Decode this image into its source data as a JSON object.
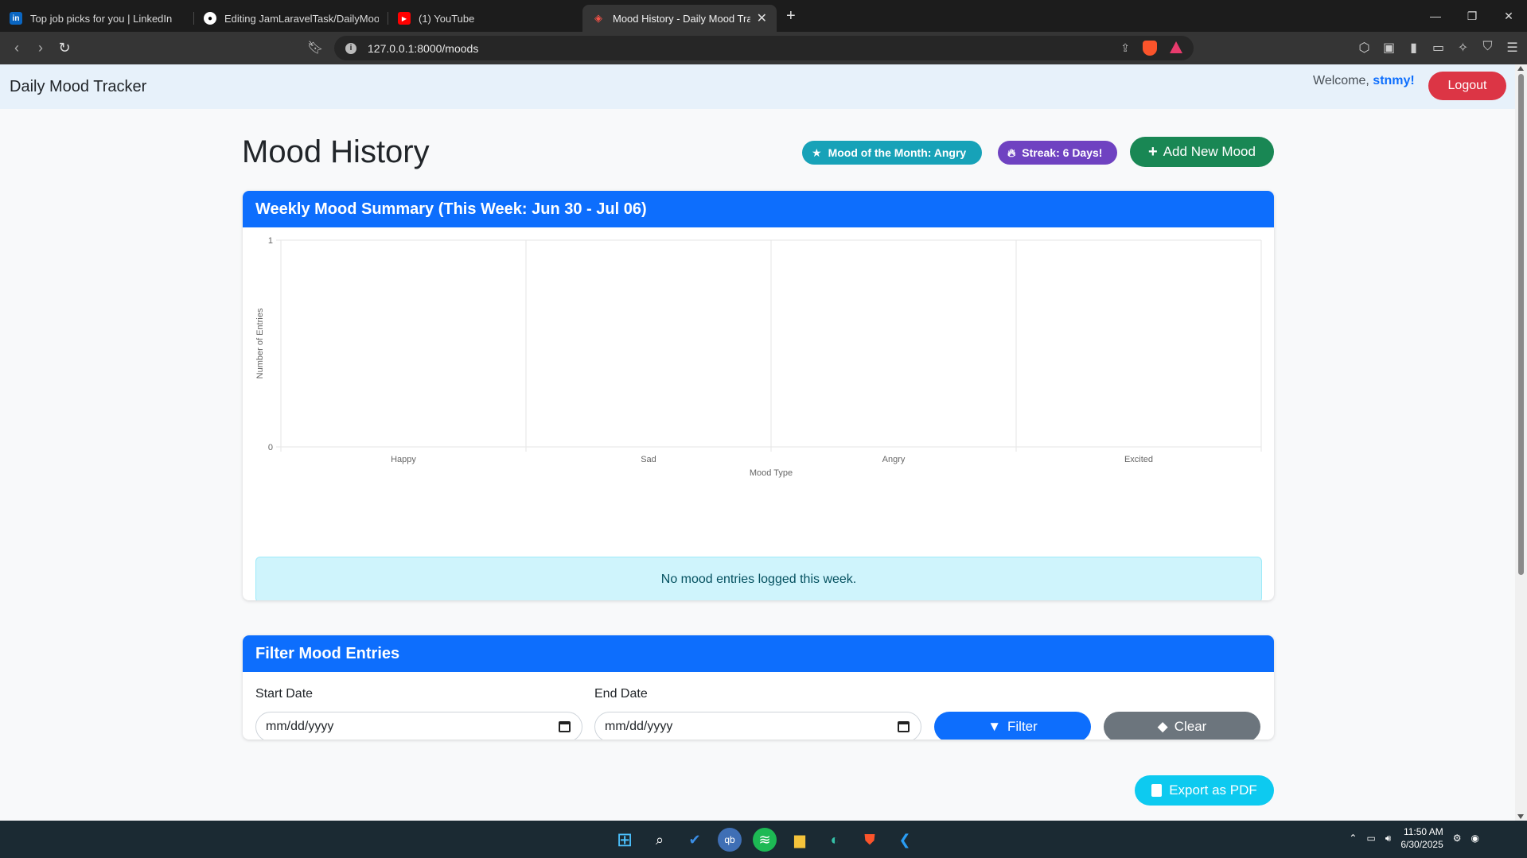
{
  "browser": {
    "tabs": [
      {
        "title": "Top job picks for you | LinkedIn",
        "favicon": "linkedin-icon",
        "active": false
      },
      {
        "title": "Editing JamLaravelTask/DailyMood/R",
        "favicon": "github-icon",
        "active": false
      },
      {
        "title": "(1) YouTube",
        "favicon": "youtube-icon",
        "active": false
      },
      {
        "title": "Mood History - Daily Mood Trac",
        "favicon": "laravel-icon",
        "active": true
      }
    ],
    "url": "127.0.0.1:8000/moods"
  },
  "navbar": {
    "brand": "Daily Mood Tracker",
    "welcome_prefix": "Welcome,",
    "username": "stnmy!",
    "logout_label": "Logout"
  },
  "header": {
    "title": "Mood History",
    "mood_of_month": "Mood of the Month: Angry",
    "streak": "Streak: 6 Days!",
    "add_label": "Add New Mood"
  },
  "summary": {
    "title": "Weekly Mood Summary (This Week: Jun 30 - Jul 06)",
    "empty_message": "No mood entries logged this week."
  },
  "chart_data": {
    "type": "bar",
    "categories": [
      "Happy",
      "Sad",
      "Angry",
      "Excited"
    ],
    "values": [
      0,
      0,
      0,
      0
    ],
    "xlabel": "Mood Type",
    "ylabel": "Number of Entries",
    "ylim": [
      0,
      1
    ],
    "yticks": [
      "0",
      "1"
    ],
    "grid": true
  },
  "filter": {
    "title": "Filter Mood Entries",
    "start_label": "Start Date",
    "start_placeholder": "mm/dd/yyyy",
    "end_label": "End Date",
    "end_placeholder": "mm/dd/yyyy",
    "filter_label": "Filter",
    "clear_label": "Clear"
  },
  "export_label": "Export as PDF",
  "taskbar": {
    "time": "11:50 AM",
    "date": "6/30/2025"
  },
  "colors": {
    "primary": "#0d6efd",
    "danger": "#dc3545",
    "success": "#198754",
    "info": "#17a2b8",
    "purple": "#6f42c1",
    "secondary": "#6c757d",
    "cyan": "#0dcaf0"
  }
}
